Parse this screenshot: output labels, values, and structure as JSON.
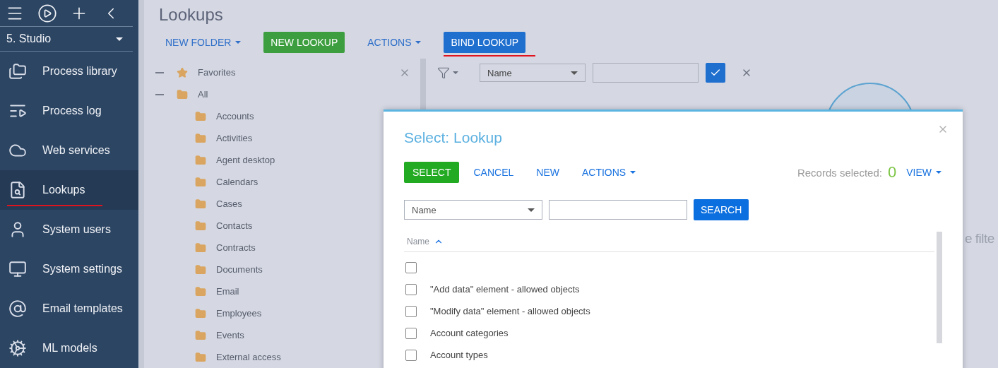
{
  "sidebar": {
    "workspace": "5. Studio",
    "items": [
      {
        "label": "Process library",
        "selected": false,
        "underlined": false
      },
      {
        "label": "Process log",
        "selected": false,
        "underlined": false
      },
      {
        "label": "Web services",
        "selected": false,
        "underlined": false
      },
      {
        "label": "Lookups",
        "selected": true,
        "underlined": true
      },
      {
        "label": "System users",
        "selected": false,
        "underlined": false
      },
      {
        "label": "System settings",
        "selected": false,
        "underlined": false
      },
      {
        "label": "Email templates",
        "selected": false,
        "underlined": false
      },
      {
        "label": "ML models",
        "selected": false,
        "underlined": false
      }
    ]
  },
  "page": {
    "title": "Lookups",
    "toolbar": [
      {
        "label": "NEW FOLDER",
        "kind": "dropdown",
        "underlined": false
      },
      {
        "label": "NEW LOOKUP",
        "kind": "green",
        "underlined": false
      },
      {
        "label": "ACTIONS",
        "kind": "dropdown",
        "underlined": false
      },
      {
        "label": "BIND LOOKUP",
        "kind": "blue",
        "underlined": true
      }
    ],
    "tree": [
      {
        "label": "Favorites",
        "kind": "favorites",
        "expanded": true
      },
      {
        "label": "All",
        "kind": "folder",
        "expanded": true,
        "children": [
          {
            "label": "Accounts"
          },
          {
            "label": "Activities"
          },
          {
            "label": "Agent desktop"
          },
          {
            "label": "Calendars"
          },
          {
            "label": "Cases"
          },
          {
            "label": "Contacts"
          },
          {
            "label": "Contracts"
          },
          {
            "label": "Documents"
          },
          {
            "label": "Email"
          },
          {
            "label": "Employees"
          },
          {
            "label": "Events"
          },
          {
            "label": "External access"
          }
        ]
      }
    ],
    "filter": {
      "column": "Name"
    },
    "hint": "e filte"
  },
  "dialog": {
    "title": "Select: Lookup",
    "toolbar": [
      {
        "label": "SELECT",
        "kind": "green"
      },
      {
        "label": "CANCEL",
        "kind": "link"
      },
      {
        "label": "NEW",
        "kind": "link"
      },
      {
        "label": "ACTIONS",
        "kind": "dropdown"
      }
    ],
    "records_label": "Records selected:",
    "records_count": "0",
    "view": "VIEW",
    "search": {
      "column": "Name",
      "button": "SEARCH"
    },
    "table": {
      "columns": [
        {
          "label": "Name",
          "sort_ascending": true
        }
      ],
      "rows": [
        {
          "checked": false
        },
        {
          "name": "\"Add data\" element - allowed objects",
          "checked": false
        },
        {
          "name": "\"Modify data\" element - allowed objects",
          "checked": false
        },
        {
          "name": "Account categories",
          "checked": false
        },
        {
          "name": "Account types",
          "checked": false
        }
      ]
    }
  }
}
